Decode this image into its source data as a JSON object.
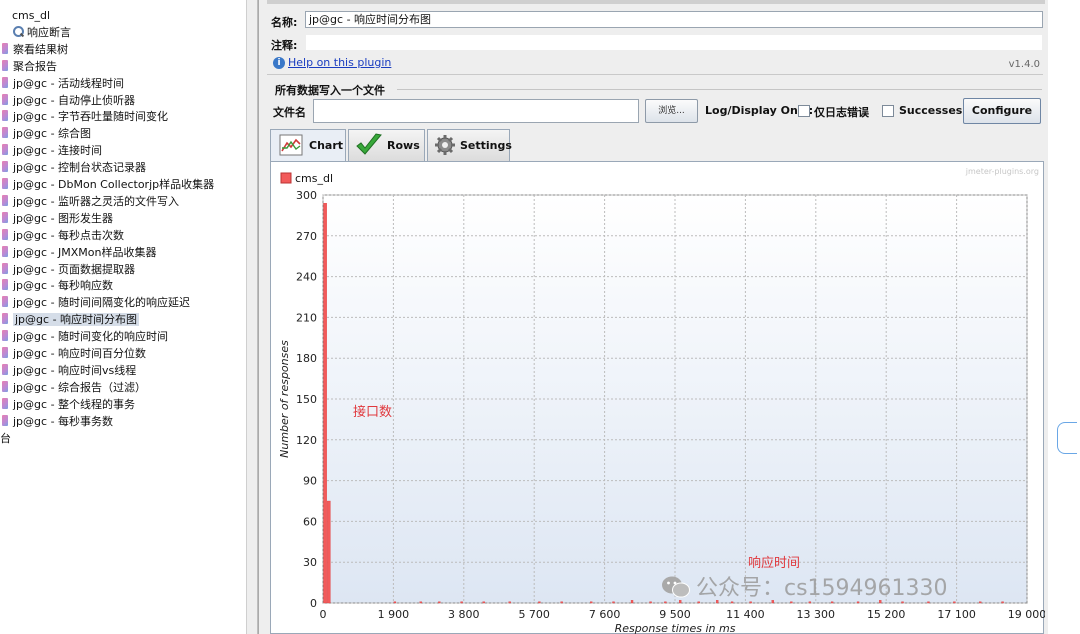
{
  "tree": {
    "items": [
      {
        "label": "cms_dl",
        "kind": "plain"
      },
      {
        "label": "响应断言",
        "kind": "assert"
      },
      {
        "label": "察看结果树",
        "kind": "listener"
      },
      {
        "label": "聚合报告",
        "kind": "listener"
      },
      {
        "label": "jp@gc - 活动线程时间",
        "kind": "listener"
      },
      {
        "label": "jp@gc - 自动停止侦听器",
        "kind": "listener"
      },
      {
        "label": "jp@gc - 字节吞吐量随时间变化",
        "kind": "listener"
      },
      {
        "label": "jp@gc - 综合图",
        "kind": "listener"
      },
      {
        "label": "jp@gc - 连接时间",
        "kind": "listener"
      },
      {
        "label": "jp@gc - 控制台状态记录器",
        "kind": "listener"
      },
      {
        "label": "jp@gc - DbMon Collectorjp样品收集器",
        "kind": "listener"
      },
      {
        "label": "jp@gc - 监听器之灵活的文件写入",
        "kind": "listener"
      },
      {
        "label": "jp@gc - 图形发生器",
        "kind": "listener"
      },
      {
        "label": "jp@gc - 每秒点击次数",
        "kind": "listener"
      },
      {
        "label": "jp@gc - JMXMon样品收集器",
        "kind": "listener"
      },
      {
        "label": "jp@gc - 页面数据提取器",
        "kind": "listener"
      },
      {
        "label": "jp@gc - 每秒响应数",
        "kind": "listener"
      },
      {
        "label": "jp@gc - 随时间间隔变化的响应延迟",
        "kind": "listener"
      },
      {
        "label": "jp@gc - 响应时间分布图",
        "kind": "listener",
        "selected": true
      },
      {
        "label": "jp@gc - 随时间变化的响应时间",
        "kind": "listener"
      },
      {
        "label": "jp@gc - 响应时间百分位数",
        "kind": "listener"
      },
      {
        "label": "jp@gc - 响应时间vs线程",
        "kind": "listener"
      },
      {
        "label": "jp@gc - 综合报告（过滤）",
        "kind": "listener"
      },
      {
        "label": "jp@gc - 整个线程的事务",
        "kind": "listener"
      },
      {
        "label": "jp@gc - 每秒事务数",
        "kind": "listener"
      },
      {
        "label": "台",
        "kind": "plain"
      }
    ]
  },
  "form": {
    "name_label": "名称:",
    "name_value": "jp@gc - 响应时间分布图",
    "comment_label": "注释:",
    "comment_value": "",
    "help_link": "Help on this plugin",
    "version": "v1.4.0",
    "group_title": "所有数据写入一个文件",
    "file_label": "文件名",
    "file_value": "",
    "browse_button": "浏览...",
    "log_display_label": "Log/Display Only:",
    "errors_only_label": "仅日志错误",
    "successes_label": "Successes",
    "configure_button": "Configure"
  },
  "tabs": [
    {
      "label": "Chart",
      "icon": "chart-icon",
      "active": true
    },
    {
      "label": "Rows",
      "icon": "checkmark-icon",
      "active": false
    },
    {
      "label": "Settings",
      "icon": "gear-icon",
      "active": false
    }
  ],
  "annotations": {
    "interface_count": "接口数",
    "response_time": "响应时间"
  },
  "watermark": "公众号：cs1594961330",
  "colors": {
    "series": "#f25a5a",
    "selected_row": "#d5dde8",
    "link": "#1a3cc0",
    "annotation": "#e0393e"
  },
  "chart_data": {
    "type": "bar",
    "watermark_text": "jmeter-plugins.org",
    "legend": [
      {
        "name": "cms_dl",
        "color": "#f25a5a"
      }
    ],
    "xlabel": "Response times in ms",
    "ylabel": "Number of responses",
    "xlim": [
      0,
      19000
    ],
    "ylim": [
      0,
      300
    ],
    "x_ticks": [
      0,
      1900,
      3800,
      5700,
      7600,
      9500,
      11400,
      13300,
      15200,
      17100,
      19000
    ],
    "x_tick_labels": [
      "0",
      "1 900",
      "3 800",
      "5 700",
      "7 600",
      "9 500",
      "11 400",
      "13 300",
      "15 200",
      "17 100",
      "19 000"
    ],
    "y_ticks": [
      0,
      30,
      60,
      90,
      120,
      150,
      180,
      210,
      240,
      270,
      300
    ],
    "bar_width_ms": 100,
    "series": [
      {
        "name": "cms_dl",
        "x": [
          0,
          100,
          1900,
          2600,
          3100,
          3700,
          4300,
          5000,
          5800,
          6400,
          7200,
          7800,
          8300,
          8800,
          9200,
          9600,
          10100,
          10600,
          11000,
          11500,
          12100,
          12600,
          13100,
          13700,
          14400,
          15000,
          15600,
          16300,
          17000,
          17700,
          18300
        ],
        "values": [
          294,
          75,
          1,
          1,
          1,
          1,
          1,
          1,
          1,
          1,
          1,
          1,
          2,
          1,
          1,
          2,
          1,
          2,
          1,
          1,
          2,
          1,
          1,
          1,
          1,
          2,
          1,
          1,
          1,
          1,
          1
        ]
      }
    ],
    "grid": true
  }
}
